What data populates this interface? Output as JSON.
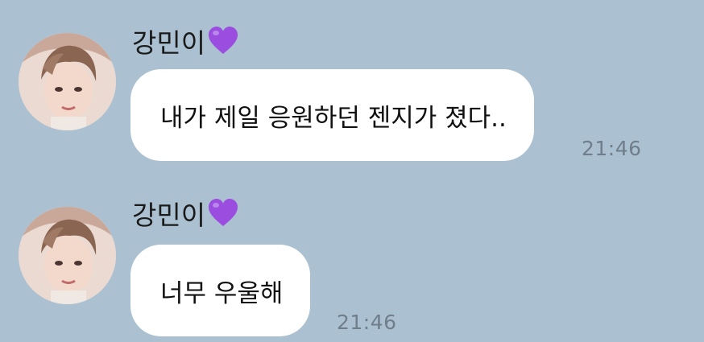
{
  "colors": {
    "background": "#abc1d1",
    "bubble": "#ffffff",
    "timestamp": "#6f7e8a",
    "heart": "#9b4de0"
  },
  "messages": [
    {
      "sender": "강민이",
      "sender_emoji": "purple-heart-icon",
      "text": "내가 제일 응원하던 젠지가 졌다..",
      "time": "21:46"
    },
    {
      "sender": "강민이",
      "sender_emoji": "purple-heart-icon",
      "text": "너무 우울해",
      "time": "21:46"
    }
  ]
}
